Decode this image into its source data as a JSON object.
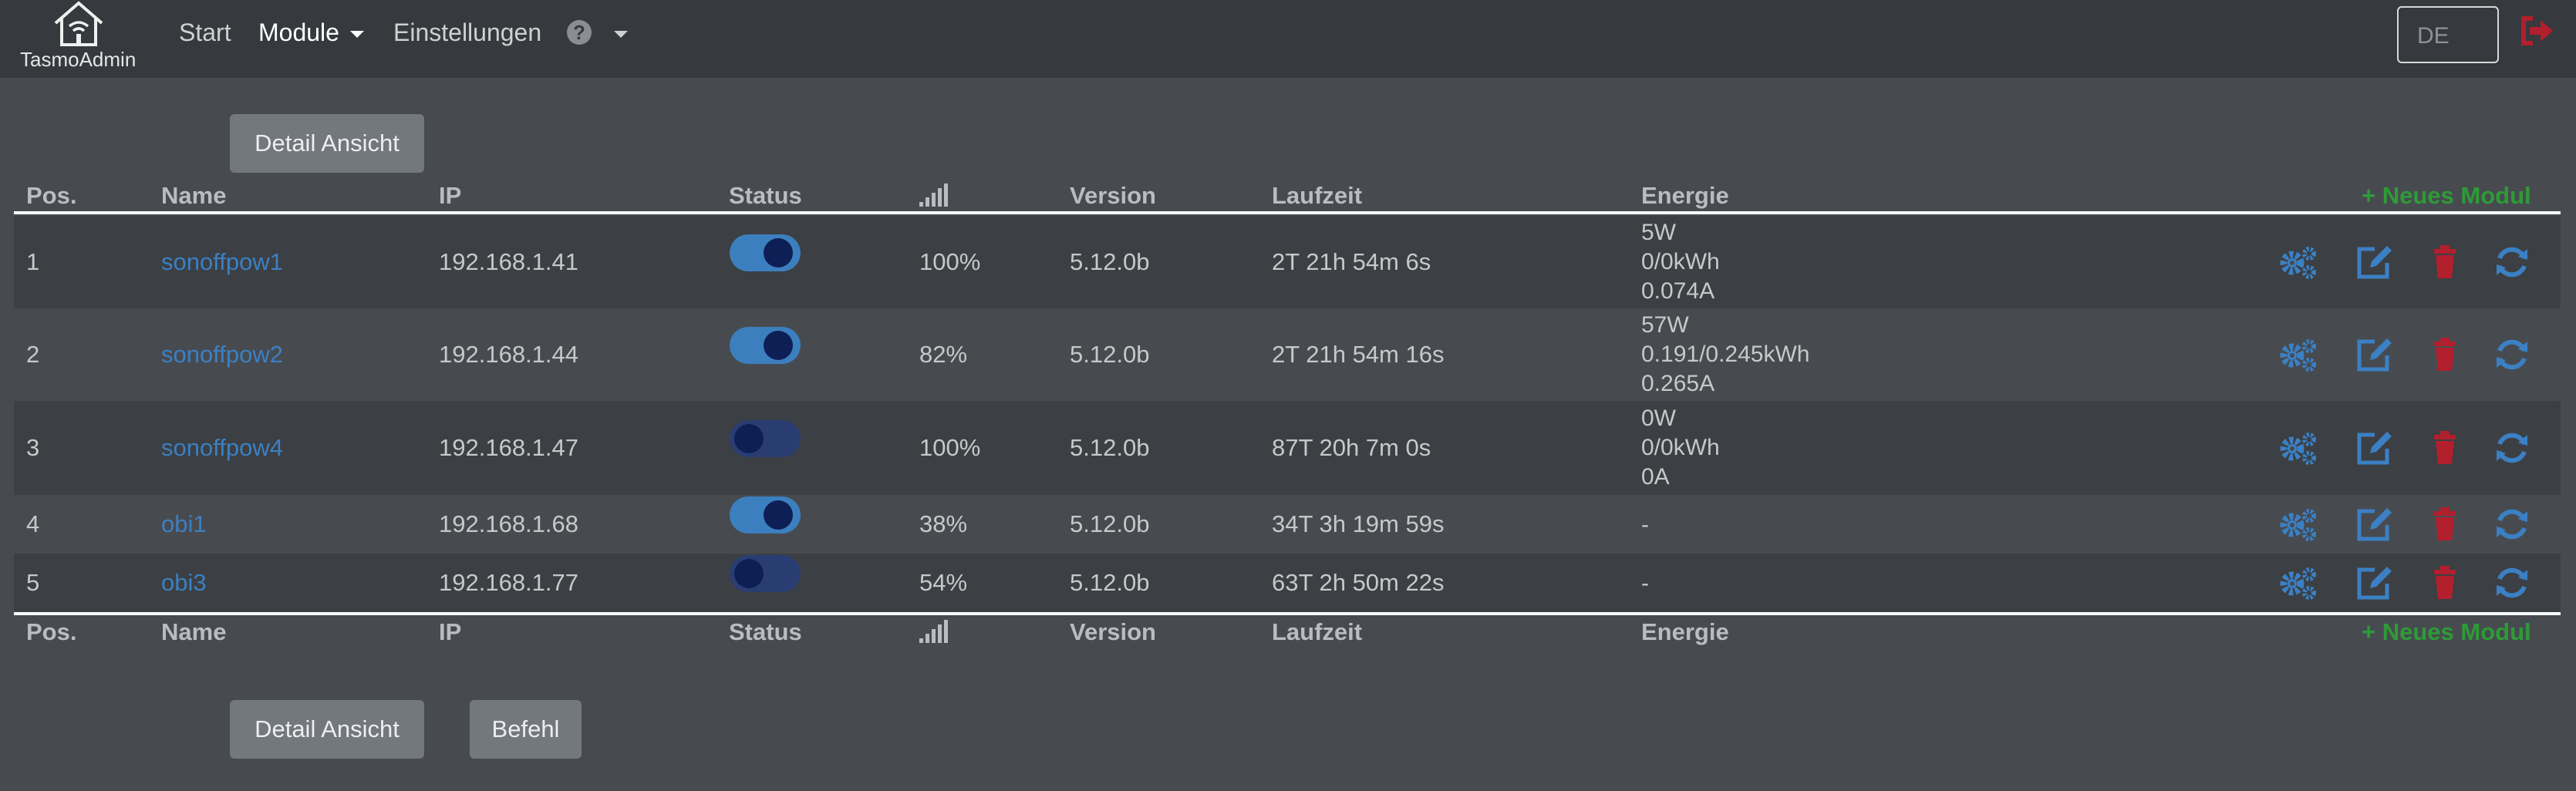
{
  "nav": {
    "brand": "TasmoAdmin",
    "start": "Start",
    "module": "Module",
    "settings": "Einstellungen",
    "language": "DE"
  },
  "buttons": {
    "detail_top": "Detail Ansicht",
    "detail_bottom": "Detail Ansicht",
    "befehl": "Befehl"
  },
  "table": {
    "headers": {
      "pos": "Pos.",
      "name": "Name",
      "ip": "IP",
      "status": "Status",
      "version": "Version",
      "runtime": "Laufzeit",
      "energy": "Energie",
      "new_module": "+ Neues Modul"
    },
    "rows": [
      {
        "pos": "1",
        "name": "sonoffpow1",
        "ip": "192.168.1.41",
        "on": true,
        "signal": "100%",
        "version": "5.12.0b",
        "runtime": "2T 21h 54m 6s",
        "energy": [
          "5W",
          "0/0kWh",
          "0.074A"
        ]
      },
      {
        "pos": "2",
        "name": "sonoffpow2",
        "ip": "192.168.1.44",
        "on": true,
        "signal": "82%",
        "version": "5.12.0b",
        "runtime": "2T 21h 54m 16s",
        "energy": [
          "57W",
          "0.191/0.245kWh",
          "0.265A"
        ]
      },
      {
        "pos": "3",
        "name": "sonoffpow4",
        "ip": "192.168.1.47",
        "on": false,
        "signal": "100%",
        "version": "5.12.0b",
        "runtime": "87T 20h 7m 0s",
        "energy": [
          "0W",
          "0/0kWh",
          "0A"
        ]
      },
      {
        "pos": "4",
        "name": "obi1",
        "ip": "192.168.1.68",
        "on": true,
        "signal": "38%",
        "version": "5.12.0b",
        "runtime": "34T 3h 19m 59s",
        "energy": [
          "-"
        ]
      },
      {
        "pos": "5",
        "name": "obi3",
        "ip": "192.168.1.77",
        "on": false,
        "signal": "54%",
        "version": "5.12.0b",
        "runtime": "63T 2h 50m 22s",
        "energy": [
          "-"
        ]
      }
    ]
  },
  "icons": {
    "home": "home-wifi-icon",
    "help": "question-circle-icon",
    "logout": "sign-out-icon",
    "signal": "signal-bars-icon",
    "config": "cogs-icon",
    "edit": "edit-icon",
    "delete": "trash-icon",
    "refresh": "refresh-icon"
  },
  "colors": {
    "link": "#3b80c4",
    "danger": "#b21f2d",
    "success": "#2e9b36",
    "toggle_on": "#3c7fbf",
    "toggle_off": "#2a3d73"
  }
}
